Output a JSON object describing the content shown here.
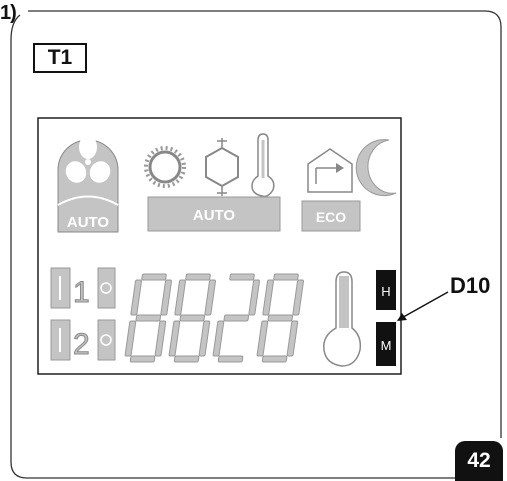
{
  "figure": {
    "number_label": "1)",
    "panel_label": "T1",
    "callout_label": "D10",
    "page_number": "42"
  },
  "display": {
    "fan_mode_label": "AUTO",
    "season_mode_label": "AUTO",
    "eco_label": "ECO",
    "zone_1": "1",
    "zone_2": "2",
    "digits": "8828",
    "indicator_h": "H",
    "indicator_m": "M"
  },
  "colors": {
    "lcd_gray": "#c4c4c4",
    "lcd_outline": "#888888",
    "indicator_fill": "#111111",
    "frame_line": "#333333"
  },
  "icons": [
    "fan-icon",
    "sun-icon",
    "snowflake-icon",
    "thermometer-icon",
    "home-arrow-icon",
    "moon-icon"
  ]
}
